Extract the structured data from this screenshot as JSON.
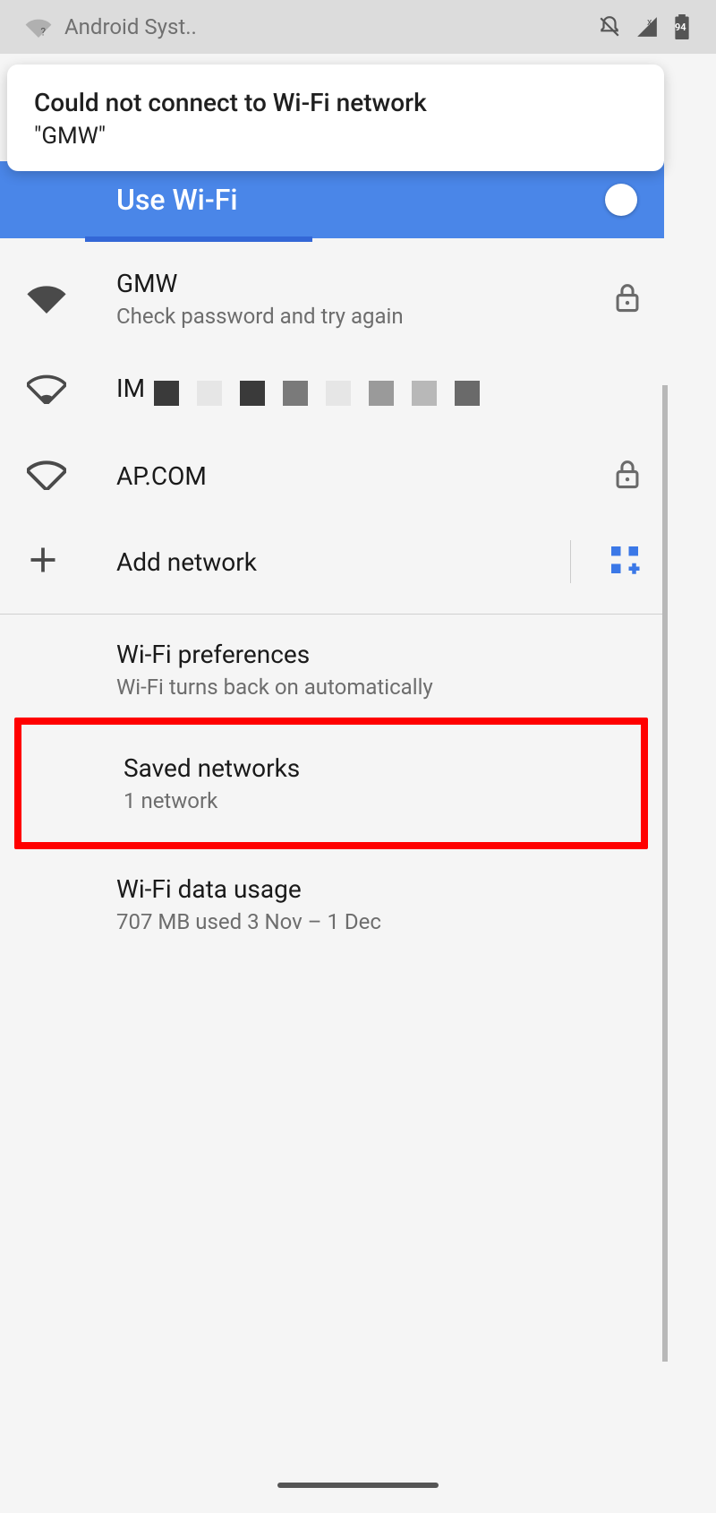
{
  "status": {
    "app_label": "Android Syst..",
    "battery": "94"
  },
  "notification": {
    "title": "Could not connect to Wi-Fi network",
    "subtitle": "\"GMW\""
  },
  "header": {
    "title": "Use Wi-Fi"
  },
  "networks": [
    {
      "name": "GMW",
      "sub": "Check password and try again",
      "signal": "full",
      "locked": true
    },
    {
      "name": "IM",
      "sub": "",
      "signal": "low",
      "locked": false,
      "blurred": true
    },
    {
      "name": "AP.COM",
      "sub": "",
      "signal": "none",
      "locked": true
    }
  ],
  "add_network": {
    "label": "Add network"
  },
  "prefs": {
    "wifi_prefs": {
      "title": "Wi-Fi preferences",
      "sub": "Wi-Fi turns back on automatically"
    },
    "saved": {
      "title": "Saved networks",
      "sub": "1 network"
    },
    "data": {
      "title": "Wi-Fi data usage",
      "sub": "707 MB used 3 Nov – 1 Dec"
    }
  }
}
